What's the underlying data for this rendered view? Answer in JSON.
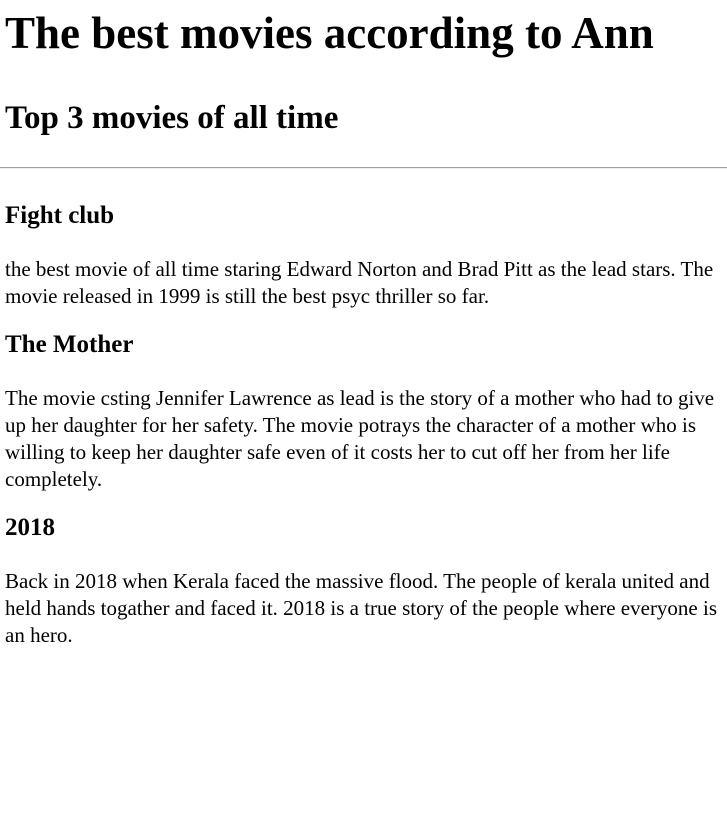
{
  "page": {
    "title": "The best movies according to Ann",
    "subtitle": "Top 3 movies of all time"
  },
  "movies": [
    {
      "title": "Fight club",
      "description": "the best movie of all time staring Edward Norton and Brad Pitt as the lead stars. The movie released in 1999 is still the best psyc thriller so far."
    },
    {
      "title": "The Mother",
      "description": "The movie csting Jennifer Lawrence as lead is the story of a mother who had to give up her daughter for her safety. The movie potrays the character of a mother who is willing to keep her daughter safe even of it costs her to cut off her from her life completely."
    },
    {
      "title": "2018",
      "description": "Back in 2018 when Kerala faced the massive flood. The people of kerala united and held hands togather and faced it. 2018 is a true story of the people where everyone is an hero."
    }
  ]
}
